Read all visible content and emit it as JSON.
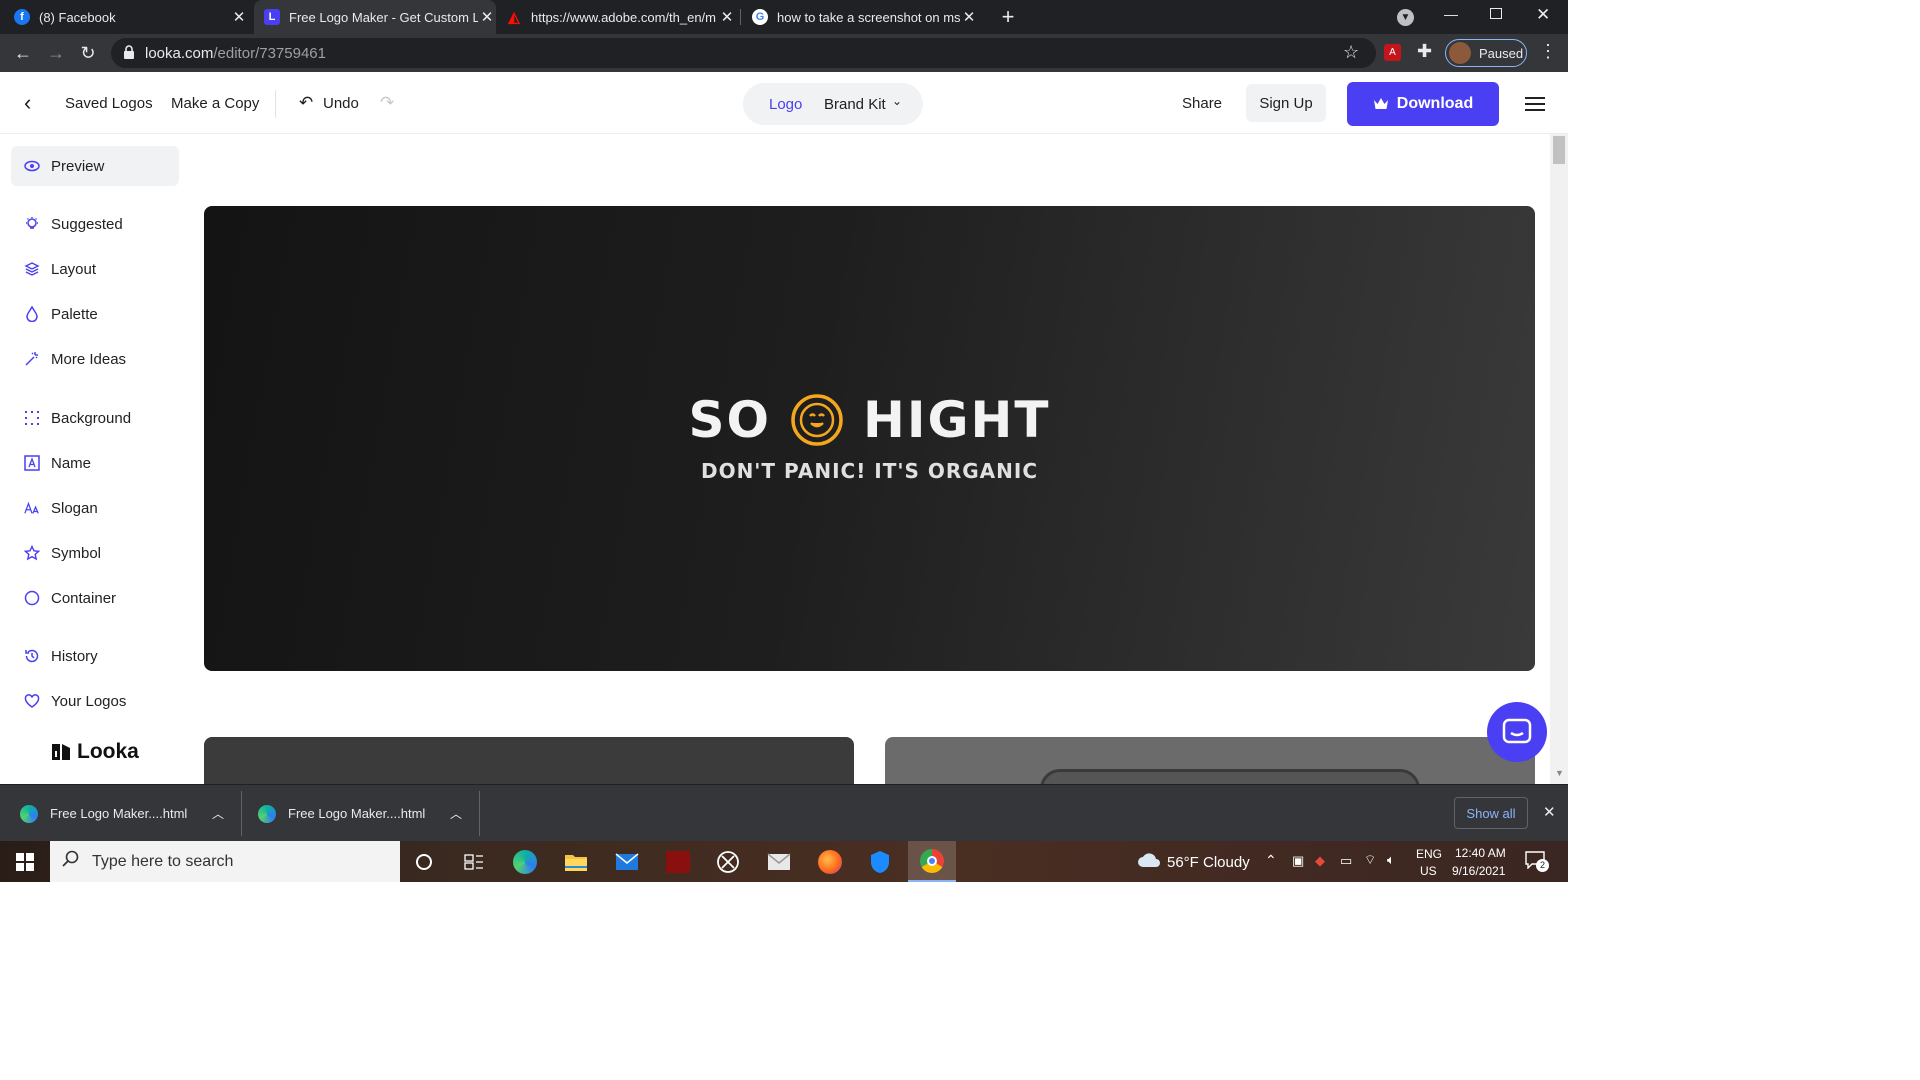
{
  "browser": {
    "tabs": [
      {
        "title": "(8) Facebook",
        "icon": "facebook-icon"
      },
      {
        "title": "Free Logo Maker - Get Custom Lo",
        "icon": "looka-icon"
      },
      {
        "title": "https://www.adobe.com/th_en/m",
        "icon": "adobe-icon"
      },
      {
        "title": "how to take a screenshot on msi",
        "icon": "google-icon"
      }
    ],
    "url_host": "looka.com",
    "url_path": "/editor/73759461",
    "profile_status": "Paused"
  },
  "header": {
    "saved_logos": "Saved Logos",
    "make_copy": "Make a Copy",
    "undo": "Undo",
    "switch_logo": "Logo",
    "switch_brand_kit": "Brand Kit",
    "share": "Share",
    "sign_up": "Sign Up",
    "download": "Download"
  },
  "sidebar": {
    "items": [
      {
        "label": "Preview",
        "icon": "eye-icon"
      },
      {
        "label": "Suggested",
        "icon": "lightbulb-icon"
      },
      {
        "label": "Layout",
        "icon": "layers-icon"
      },
      {
        "label": "Palette",
        "icon": "drop-icon"
      },
      {
        "label": "More Ideas",
        "icon": "magic-wand-icon"
      },
      {
        "label": "Background",
        "icon": "grid-dots-icon"
      },
      {
        "label": "Name",
        "icon": "text-box-icon"
      },
      {
        "label": "Slogan",
        "icon": "font-size-icon"
      },
      {
        "label": "Symbol",
        "icon": "star-icon"
      },
      {
        "label": "Container",
        "icon": "circle-icon"
      },
      {
        "label": "History",
        "icon": "history-icon"
      },
      {
        "label": "Your Logos",
        "icon": "heart-icon"
      }
    ],
    "brand": "Looka"
  },
  "logo": {
    "name_left": "SO",
    "name_right": "HIGHT",
    "slogan": "DON'T PANIC! IT'S ORGANIC",
    "symbol": "smiley-face-icon",
    "accent_color": "#f4a71d",
    "text_color": "#f3f3f3"
  },
  "downloads": {
    "items": [
      {
        "name": "Free Logo Maker....html",
        "icon": "edge-icon"
      },
      {
        "name": "Free Logo Maker....html",
        "icon": "edge-icon"
      }
    ],
    "show_all": "Show all"
  },
  "taskbar": {
    "search_placeholder": "Type here to search",
    "weather": "56°F  Cloudy",
    "lang_top": "ENG",
    "lang_bottom": "US",
    "time": "12:40 AM",
    "date": "9/16/2021",
    "notifications": "2"
  },
  "colors": {
    "brand_primary": "#4a3ff2",
    "chrome_dark": "#202124",
    "chrome_toolbar": "#35363a"
  }
}
